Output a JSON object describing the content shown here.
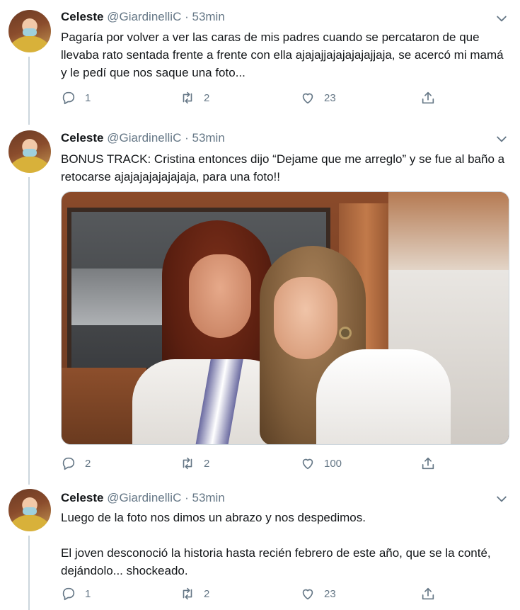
{
  "tweets": [
    {
      "name": "Celeste",
      "handle": "@GiardinelliC",
      "separator": "·",
      "time": "53min",
      "text": "Pagaría por volver a ver las caras de mis padres cuando se percataron de que llevaba rato sentada frente a frente con ella ajajajjajajajajajjaja, se acercó mi mamá y le pedí que nos saque una foto...",
      "reply_count": "1",
      "retweet_count": "2",
      "like_count": "23"
    },
    {
      "name": "Celeste",
      "handle": "@GiardinelliC",
      "separator": "·",
      "time": "53min",
      "text": "BONUS TRACK: Cristina entonces dijo “Dejame que me arreglo” y se fue al baño a retocarse ajajajajajajajaja, para una foto!!",
      "reply_count": "2",
      "retweet_count": "2",
      "like_count": "100"
    },
    {
      "name": "Celeste",
      "handle": "@GiardinelliC",
      "separator": "·",
      "time": "53min",
      "text": "Luego de la foto nos dimos un abrazo y nos despedimos.\n\nEl joven desconoció la historia hasta recién febrero de este año, que se la conté, dejándolo... shockeado.",
      "reply_count": "1",
      "retweet_count": "2",
      "like_count": "23"
    }
  ],
  "icons": {
    "reply": "reply-icon",
    "retweet": "retweet-icon",
    "like": "like-icon",
    "share": "share-icon",
    "caret": "chevron-down-icon"
  },
  "colors": {
    "text": "#14171a",
    "secondary": "#657786",
    "thread_line": "#ccd6dd"
  }
}
